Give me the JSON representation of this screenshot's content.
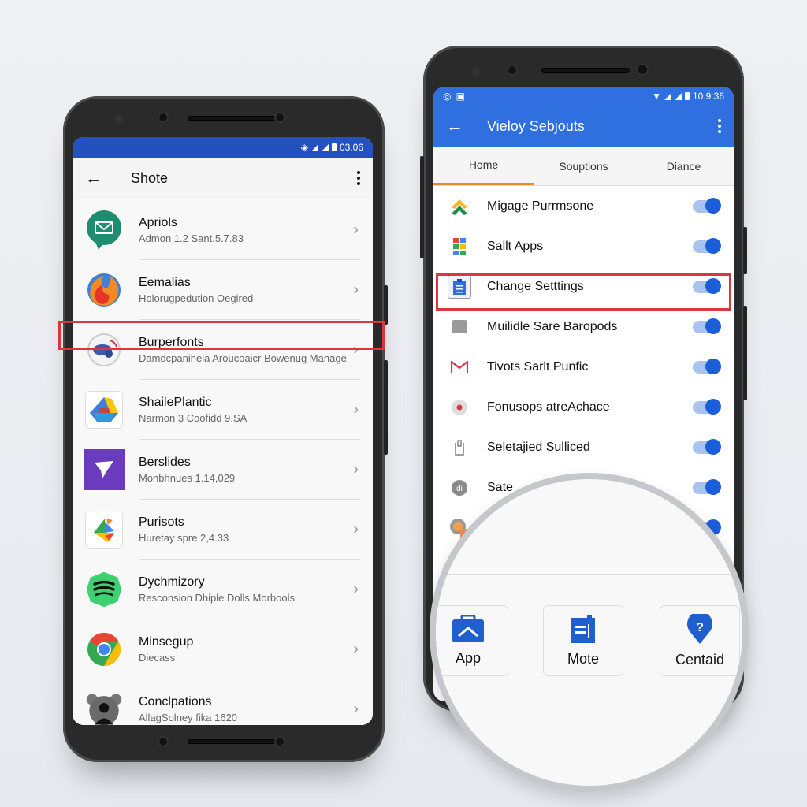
{
  "left_phone": {
    "status_time": "03.06",
    "appbar_title": "Shote",
    "items": [
      {
        "name": "Apriols",
        "sub": "Admon 1.2 Sant.5.7.83",
        "icon": "message-bubble-icon"
      },
      {
        "name": "Eemalias",
        "sub": "Holorugpedution Oegired",
        "icon": "flame-logo-icon"
      },
      {
        "name": "Burperfonts",
        "sub": "Damdcpaniheia Aroucoaicr Bowenug Manage",
        "icon": "toggle-logo-icon",
        "highlighted": true
      },
      {
        "name": "ShailePlantic",
        "sub": "Narmon 3 Coofidd 9.SA",
        "icon": "drive-logo-icon"
      },
      {
        "name": "Berslides",
        "sub": "Monbhnues 1.14,029",
        "icon": "slides-logo-icon"
      },
      {
        "name": "Purisots",
        "sub": "Huretay spre 2,4.33",
        "icon": "colorful-logo-icon"
      },
      {
        "name": "Dychmizory",
        "sub": "Resconsion Dhiple Dolls Morbools",
        "icon": "spotify-logo-icon"
      },
      {
        "name": "Minsegup",
        "sub": "Diecass",
        "icon": "chrome-logo-icon"
      },
      {
        "name": "Conclpations",
        "sub": "AllagSolney fika 1620",
        "icon": "bear-avatar-icon"
      }
    ]
  },
  "right_phone": {
    "status_time": "10.9.36",
    "appbar_title": "Vieloy Sebjouts",
    "tabs": [
      {
        "label": "Home",
        "active": true
      },
      {
        "label": "Souptions",
        "active": false
      },
      {
        "label": "Diance",
        "active": false
      }
    ],
    "items": [
      {
        "name": "Migage Purrmsone",
        "on": true,
        "icon": "chevron-up-logo-icon"
      },
      {
        "name": "Sallt Apps",
        "on": true,
        "icon": "apps-grid-icon"
      },
      {
        "name": "Change Setttings",
        "on": true,
        "icon": "clipboard-icon",
        "highlighted": true
      },
      {
        "name": "Muilidle Sare Baropods",
        "on": true,
        "icon": "gray-square-icon"
      },
      {
        "name": "Tivots Sarlt Punfic",
        "on": true,
        "icon": "gmail-icon"
      },
      {
        "name": "Fonusops atreAchace",
        "on": true,
        "icon": "red-dot-icon"
      },
      {
        "name": "Seletajied Sulliced",
        "on": true,
        "icon": "phone-outline-icon"
      },
      {
        "name": "Sate",
        "on": true,
        "icon": "gray-circle-icon"
      },
      {
        "name": "",
        "on": true,
        "icon": "orange-badge-icon"
      }
    ],
    "magnifier_cards": [
      {
        "label": "App",
        "icon": "briefcase-icon"
      },
      {
        "label": "Mote",
        "icon": "note-icon"
      },
      {
        "label": "Centaid",
        "icon": "help-pin-icon"
      }
    ]
  },
  "colors": {
    "left_statusbar": "#2450c0",
    "right_appbar": "#2f6fe0",
    "highlight": "#d9363e",
    "toggle_on": "#1a5fd9",
    "tab_indicator": "#e8892a"
  }
}
